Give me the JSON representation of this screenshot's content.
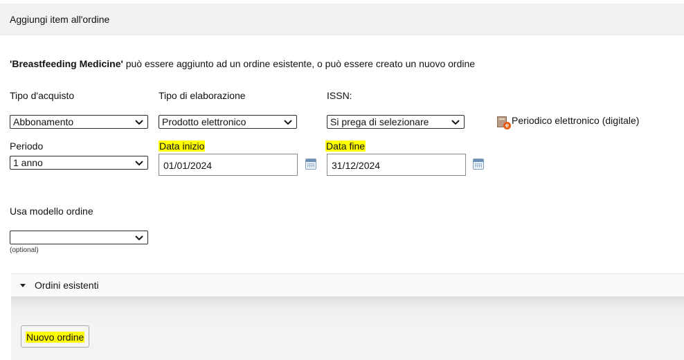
{
  "header": {
    "title": "Aggiungi item all'ordine"
  },
  "intro": {
    "item_name": "'Breastfeeding Medicine'",
    "text": " può essere aggiunto ad un ordine esistente, o può essere creato un nuovo ordine"
  },
  "form": {
    "purchase_type": {
      "label": "Tipo d'acquisto",
      "value": "Abbonamento"
    },
    "processing_type": {
      "label": "Tipo di elaborazione",
      "value": "Prodotto elettronico"
    },
    "issn": {
      "label": "ISSN:",
      "value": "Si prega di selezionare"
    },
    "format_badge": {
      "icon": "electronic-periodical-icon",
      "label": "Periodico elettronico (digitale)"
    },
    "period": {
      "label": "Periodo",
      "value": "1 anno"
    },
    "start_date": {
      "label": "Data inizio",
      "value": "01/01/2024"
    },
    "end_date": {
      "label": "Data fine",
      "value": "31/12/2024"
    },
    "order_template": {
      "label": "Usa modello ordine",
      "value": "",
      "hint": "(optional)"
    }
  },
  "existing_orders": {
    "label": "Ordini esistenti"
  },
  "actions": {
    "new_order_label": "Nuovo ordine"
  },
  "colors": {
    "highlight": "#ffff00",
    "header_bg": "#f1f1f1"
  }
}
